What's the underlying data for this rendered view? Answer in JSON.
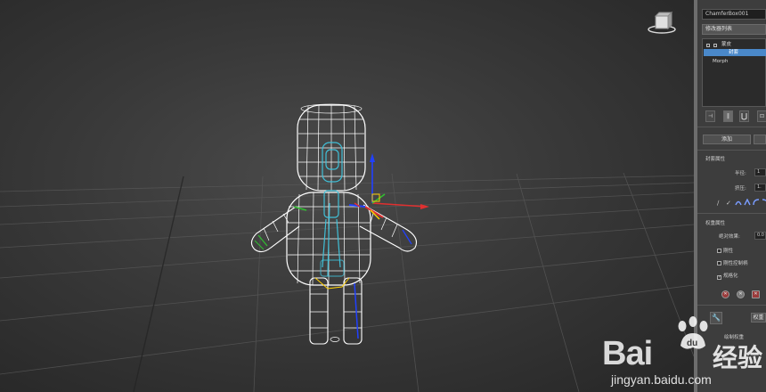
{
  "object_name": "ChamferBox001",
  "modifier_list_label": "修改器列表",
  "modifier_stack": [
    {
      "label": "蒙皮",
      "selected": false
    },
    {
      "label": "封套",
      "selected": true
    },
    {
      "label": "Morph",
      "selected": false
    }
  ],
  "stack_tools": [
    "⊣",
    "‖",
    "",
    "⊡"
  ],
  "add_button": "添加",
  "envelope_section": {
    "title": "封套属性",
    "radius_label": "半径:",
    "radius_value": "1",
    "squash_label": "挤压:",
    "squash_value": "1."
  },
  "weight_section": {
    "title": "权重属性",
    "absolute_effect_label": "绝对效果:",
    "absolute_effect_value": "0.0",
    "checkbox_rigid": "刚性",
    "checkbox_rigid_handles": "刚性控制柄",
    "checkbox_normalize": "规格化",
    "weight_button": "权重",
    "paint_label": "绘制权重"
  },
  "watermark": {
    "brand": "Bai",
    "brand_du": "du",
    "cn_text": "经验",
    "url": "jingyan.baidu.com"
  },
  "colors": {
    "viewport_bg": "#3a3a3a",
    "wireframe": "#ffffff",
    "selection_blue": "#4a88c9",
    "skeleton": "#40c0d8",
    "gizmo_x": "#e03030",
    "gizmo_y": "#30c030",
    "gizmo_z": "#2040ff"
  },
  "icons": [
    "viewcube-icon",
    "wrench-icon",
    "pin-stack-icon",
    "show-end-result-icon",
    "make-unique-icon",
    "remove-modifier-icon",
    "configure-sets-icon"
  ]
}
